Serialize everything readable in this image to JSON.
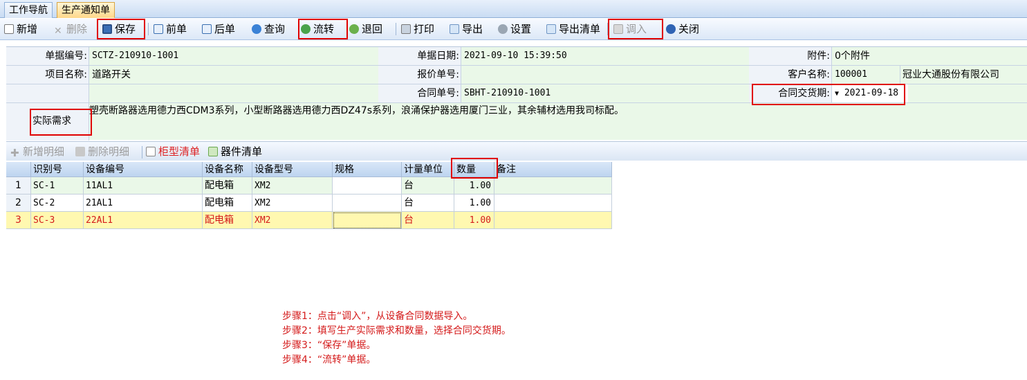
{
  "tabs": [
    {
      "label": "工作导航"
    },
    {
      "label": "生产通知单"
    }
  ],
  "toolbar": {
    "new": "新增",
    "delete": "删除",
    "save": "保存",
    "prev": "前单",
    "next": "后单",
    "query": "查询",
    "flow": "流转",
    "back": "退回",
    "print": "打印",
    "export": "导出",
    "settings": "设置",
    "export_list": "导出清单",
    "import": "调入",
    "close": "关闭"
  },
  "form": {
    "doc_no_label": "单据编号:",
    "doc_no": "SCTZ-210910-1001",
    "doc_date_label": "单据日期:",
    "doc_date": "2021-09-10 15:39:50",
    "attach_label": "附件:",
    "attach": "0个附件",
    "project_label": "项目名称:",
    "project": "道路开关",
    "quote_label": "报价单号:",
    "quote": "",
    "customer_label": "客户名称:",
    "customer_code": "100001",
    "customer_name": "冠业大通股份有限公司",
    "contract_label": "合同单号:",
    "contract": "SBHT-210910-1001",
    "delivery_label": "合同交货期:",
    "delivery": "2021-09-18",
    "requirement_label": "实际需求",
    "requirement": "塑壳断路器选用德力西CDM3系列，小型断路器选用德力西DZ47s系列，浪涌保护器选用厦门三业，其余辅材选用我司标配。"
  },
  "detail_toolbar": {
    "add": "新增明细",
    "remove": "删除明细",
    "cabinet": "柜型清单",
    "parts": "器件清单"
  },
  "grid": {
    "headers": [
      "识别号",
      "设备编号",
      "设备名称",
      "设备型号",
      "规格",
      "计量单位",
      "数量",
      "备注"
    ],
    "rows": [
      {
        "n": "1",
        "id": "SC-1",
        "code": "11AL1",
        "name": "配电箱",
        "model": "XM2",
        "spec": "",
        "unit": "台",
        "qty": "1.00",
        "note": ""
      },
      {
        "n": "2",
        "id": "SC-2",
        "code": "21AL1",
        "name": "配电箱",
        "model": "XM2",
        "spec": "",
        "unit": "台",
        "qty": "1.00",
        "note": ""
      },
      {
        "n": "3",
        "id": "SC-3",
        "code": "22AL1",
        "name": "配电箱",
        "model": "XM2",
        "spec": "",
        "unit": "台",
        "qty": "1.00",
        "note": ""
      }
    ]
  },
  "annotations": [
    "步骤1：点击“调入”，从设备合同数据导入。",
    "步骤2：填写生产实际需求和数量，选择合同交货期。",
    "步骤3：“保存”单据。",
    "步骤4：“流转”单据。"
  ],
  "colors": {
    "highlight": "#e00000",
    "selected_row": "#fff8b0",
    "row_alt": "#eaf8e8",
    "annotation": "#d41a1a"
  }
}
